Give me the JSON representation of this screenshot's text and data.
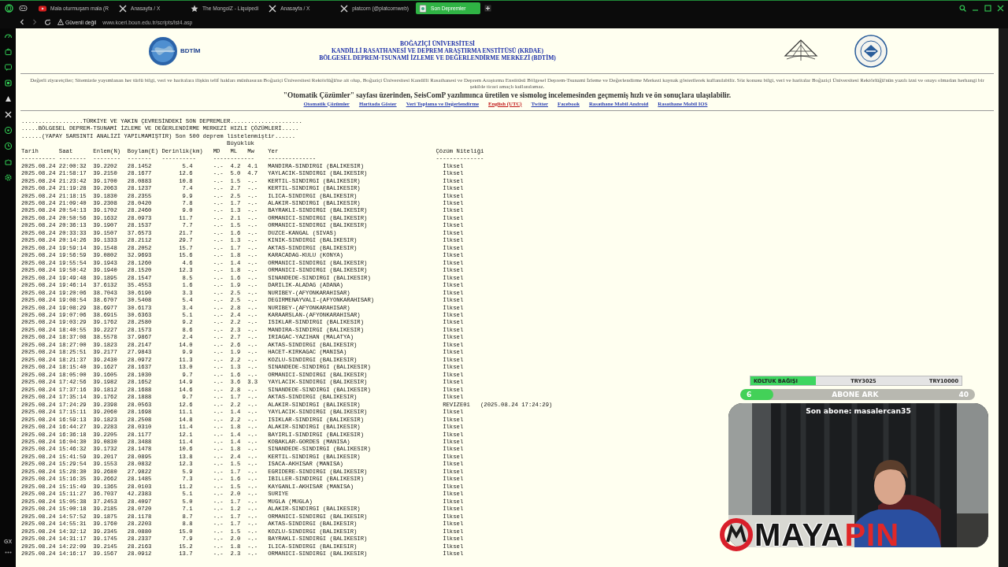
{
  "browser": {
    "tabs": [
      {
        "kind": "video",
        "label": "Mala oturmuşam mala (R",
        "selected": false
      },
      {
        "kind": "x",
        "label": "Anasayfa / X",
        "selected": false
      },
      {
        "kind": "wiki",
        "label": "The MongolZ - Liquipedi",
        "selected": false
      },
      {
        "kind": "x",
        "label": "Anasayfa / X",
        "selected": false
      },
      {
        "kind": "x",
        "label": "platcorn (@platcornweb)",
        "selected": false
      },
      {
        "kind": "page",
        "label": "Son Depremler",
        "selected": true
      }
    ],
    "security": "Güvenli değil",
    "url": "www.koeri.boun.edu.tr/scripts/lst4.asp",
    "sidebar_label": "GX"
  },
  "header": {
    "logo_text": "BDTİM",
    "title_lines": [
      "BOĞAZİÇİ ÜNİVERSİTESİ",
      "KANDİLLİ RASATHANESİ VE DEPREM ARAŞTIRMA ENSTİTÜSÜ (KRDAE)",
      "BÖLGESEL DEPREM-TSUNAMİ İZLEME VE DEĞERLENDİRME MERKEZİ (BDTİM)"
    ],
    "notice": "Değerli ziyaretçiler; Sitemizde yayımlanan her türlü bilgi, veri ve haritalara ilişkin telif hakları münhasıran Boğaziçi Üniversitesi Rektörlüğü'ne ait olup, Boğaziçi Üniversitesi Kandilli Rasathanesi ve Deprem Araştırma Enstitüsü Bölgesel Deprem-Tsunami İzleme ve Değerlendirme Merkezi kaynak gösterilerek kullanılabilir. Söz konusu bilgi, veri ve haritalar Boğaziçi Üniversitesi Rektörlüğü'nün yazılı izni ve onayı olmadan herhangi bir şekilde ticari amaçlı kullanılamaz.",
    "announcement": "\"Otomatik Çözümler\" sayfası üzerinden, SeisComP yazılımınca üretilen ve sismolog incelemesinden geçmemiş hızlı ve ön sonuçlara ulaşılabilir.",
    "links": [
      {
        "kind": "page",
        "label": "Otomatik Çözümler"
      },
      {
        "kind": "page",
        "label": "Haritada Göster"
      },
      {
        "kind": "page",
        "label": "Veri Toplama ve Değerlendirme"
      },
      {
        "kind": "language",
        "label": "English (UTC)"
      },
      {
        "kind": "page",
        "label": "Twitter"
      },
      {
        "kind": "page",
        "label": "Facebook"
      },
      {
        "kind": "page",
        "label": "Rasathane Mobil Android"
      },
      {
        "kind": "page",
        "label": "Rasathane Mobil IOS"
      }
    ]
  },
  "quake_list": {
    "title_lines": [
      "..................TÜRKİYE VE YAKIN ÇEVRESİNDEKİ SON DEPREMLER.....................",
      ".....BÖLGESEL DEPREM-TSUNAMİ İZLEME VE DEĞERLENDİRME MERKEZİ HIZLI ÇÖZÜMLERİ.....",
      "......(YAPAY SARSINTI ANALİZİ YAPILMAMIŞTIR) Son 500 deprem listelenmiştir......"
    ],
    "magnitude_heading": "Büyüklük",
    "columns": [
      {
        "label": "Tarih"
      },
      {
        "label": "Saat"
      },
      {
        "label": "Enlem(N)"
      },
      {
        "label": "Boylam(E)"
      },
      {
        "label": "Derinlik(km)"
      },
      {
        "label": "MD"
      },
      {
        "label": "ML"
      },
      {
        "label": "Mw"
      },
      {
        "label": "Yer"
      },
      {
        "label": "Çözüm Niteliği"
      }
    ],
    "header_rule": "---------- --------  --------  -------   ----------     ------------    --------------                                   --------------",
    "rows": [
      {
        "date": "2025.08.24",
        "time": "22:00:32",
        "lat": "39.2202",
        "lon": "28.1452",
        "depth": "5.4",
        "md": "-.-",
        "ml": "4.2",
        "mw": "4.1",
        "place": "MANDIRA-SINDIRGI (BALIKESIR)",
        "quality": "İlksel"
      },
      {
        "date": "2025.08.24",
        "time": "21:58:17",
        "lat": "39.2150",
        "lon": "28.1677",
        "depth": "12.6",
        "md": "-.-",
        "ml": "5.0",
        "mw": "4.7",
        "place": "YAYLACIK-SINDIRGI (BALIKESIR)",
        "quality": "İlksel"
      },
      {
        "date": "2025.08.24",
        "time": "21:23:42",
        "lat": "39.1700",
        "lon": "28.0883",
        "depth": "10.8",
        "md": "-.-",
        "ml": "1.5",
        "mw": "-.-",
        "place": "KERTIL-SINDIRGI (BALIKESIR)",
        "quality": "İlksel"
      },
      {
        "date": "2025.08.24",
        "time": "21:19:28",
        "lat": "39.2063",
        "lon": "28.1237",
        "depth": "7.4",
        "md": "-.-",
        "ml": "2.7",
        "mw": "-.-",
        "place": "KERTIL-SINDIRGI (BALIKESIR)",
        "quality": "İlksel"
      },
      {
        "date": "2025.08.24",
        "time": "21:18:15",
        "lat": "39.1830",
        "lon": "28.2355",
        "depth": "9.9",
        "md": "-.-",
        "ml": "2.5",
        "mw": "-.-",
        "place": "ILICA-SINDIRGI (BALIKESIR)",
        "quality": "İlksel"
      },
      {
        "date": "2025.08.24",
        "time": "21:09:40",
        "lat": "39.2308",
        "lon": "28.0420",
        "depth": "7.8",
        "md": "-.-",
        "ml": "1.7",
        "mw": "-.-",
        "place": "ALAKIR-SINDIRGI (BALIKESIR)",
        "quality": "İlksel"
      },
      {
        "date": "2025.08.24",
        "time": "20:54:13",
        "lat": "39.1702",
        "lon": "28.2460",
        "depth": "9.0",
        "md": "-.-",
        "ml": "1.3",
        "mw": "-.-",
        "place": "BAYRAKLI-SINDIRGI (BALIKESIR)",
        "quality": "İlksel"
      },
      {
        "date": "2025.08.24",
        "time": "20:50:56",
        "lat": "39.1632",
        "lon": "28.0973",
        "depth": "11.7",
        "md": "-.-",
        "ml": "2.1",
        "mw": "-.-",
        "place": "ORMANICI-SINDIRGI (BALIKESIR)",
        "quality": "İlksel"
      },
      {
        "date": "2025.08.24",
        "time": "20:36:13",
        "lat": "39.1907",
        "lon": "28.1537",
        "depth": "7.7",
        "md": "-.-",
        "ml": "1.5",
        "mw": "-.-",
        "place": "ORMANICI-SINDIRGI (BALIKESIR)",
        "quality": "İlksel"
      },
      {
        "date": "2025.08.24",
        "time": "20:33:33",
        "lat": "39.1507",
        "lon": "37.6573",
        "depth": "21.7",
        "md": "-.-",
        "ml": "1.6",
        "mw": "-.-",
        "place": "DUZCE-KANGAL (SIVAS)",
        "quality": "İlksel"
      },
      {
        "date": "2025.08.24",
        "time": "20:14:26",
        "lat": "39.1333",
        "lon": "28.2112",
        "depth": "29.7",
        "md": "-.-",
        "ml": "1.3",
        "mw": "-.-",
        "place": "KINIK-SINDIRGI (BALIKESIR)",
        "quality": "İlksel"
      },
      {
        "date": "2025.08.24",
        "time": "19:59:14",
        "lat": "39.1548",
        "lon": "28.2052",
        "depth": "15.7",
        "md": "-.-",
        "ml": "1.7",
        "mw": "-.-",
        "place": "AKTAS-SINDIRGI (BALIKESIR)",
        "quality": "İlksel"
      },
      {
        "date": "2025.08.24",
        "time": "19:56:59",
        "lat": "39.0802",
        "lon": "32.9693",
        "depth": "15.6",
        "md": "-.-",
        "ml": "1.8",
        "mw": "-.-",
        "place": "KARACADAG-KULU (KONYA)",
        "quality": "İlksel"
      },
      {
        "date": "2025.08.24",
        "time": "19:55:54",
        "lat": "39.1943",
        "lon": "28.1260",
        "depth": "4.6",
        "md": "-.-",
        "ml": "1.4",
        "mw": "-.-",
        "place": "ORMANICI-SINDIRGI (BALIKESIR)",
        "quality": "İlksel"
      },
      {
        "date": "2025.08.24",
        "time": "19:50:42",
        "lat": "39.1940",
        "lon": "28.1520",
        "depth": "12.3",
        "md": "-.-",
        "ml": "1.8",
        "mw": "-.-",
        "place": "ORMANICI-SINDIRGI (BALIKESIR)",
        "quality": "İlksel"
      },
      {
        "date": "2025.08.24",
        "time": "19:49:48",
        "lat": "39.1895",
        "lon": "28.1547",
        "depth": "8.5",
        "md": "-.-",
        "ml": "1.6",
        "mw": "-.-",
        "place": "SINANDEDE-SINDIRGI (BALIKESIR)",
        "quality": "İlksel"
      },
      {
        "date": "2025.08.24",
        "time": "19:46:14",
        "lat": "37.6132",
        "lon": "35.4553",
        "depth": "1.6",
        "md": "-.-",
        "ml": "1.9",
        "mw": "-.-",
        "place": "DARILIK-ALADAG (ADANA)",
        "quality": "İlksel"
      },
      {
        "date": "2025.08.24",
        "time": "19:20:06",
        "lat": "38.7043",
        "lon": "30.6190",
        "depth": "3.3",
        "md": "-.-",
        "ml": "2.5",
        "mw": "-.-",
        "place": "NURIBEY-(AFYONKARAHISAR)",
        "quality": "İlksel"
      },
      {
        "date": "2025.08.24",
        "time": "19:08:54",
        "lat": "38.6707",
        "lon": "30.5408",
        "depth": "5.4",
        "md": "-.-",
        "ml": "2.5",
        "mw": "-.-",
        "place": "DEGIRMENAYVALI-(AFYONKARAHISAR)",
        "quality": "İlksel"
      },
      {
        "date": "2025.08.24",
        "time": "19:08:29",
        "lat": "38.6977",
        "lon": "30.6173",
        "depth": "3.4",
        "md": "-.-",
        "ml": "2.8",
        "mw": "-.-",
        "place": "NURIBEY-(AFYONKARAHISAR)",
        "quality": "İlksel"
      },
      {
        "date": "2025.08.24",
        "time": "19:07:06",
        "lat": "38.6915",
        "lon": "30.6363",
        "depth": "5.1",
        "md": "-.-",
        "ml": "2.4",
        "mw": "-.-",
        "place": "KARAARSLAN-(AFYONKARAHISAR)",
        "quality": "İlksel"
      },
      {
        "date": "2025.08.24",
        "time": "19:03:29",
        "lat": "39.1762",
        "lon": "28.2580",
        "depth": "9.2",
        "md": "-.-",
        "ml": "2.2",
        "mw": "-.-",
        "place": "ISIKLAR-SINDIRGI (BALIKESIR)",
        "quality": "İlksel"
      },
      {
        "date": "2025.08.24",
        "time": "18:40:55",
        "lat": "39.2227",
        "lon": "28.1573",
        "depth": "8.6",
        "md": "-.-",
        "ml": "2.3",
        "mw": "-.-",
        "place": "MANDIRA-SINDIRGI (BALIKESIR)",
        "quality": "İlksel"
      },
      {
        "date": "2025.08.24",
        "time": "18:37:08",
        "lat": "38.5578",
        "lon": "37.9867",
        "depth": "2.4",
        "md": "-.-",
        "ml": "2.7",
        "mw": "-.-",
        "place": "IRIAGAC-YAZIHAN (MALATYA)",
        "quality": "İlksel"
      },
      {
        "date": "2025.08.24",
        "time": "18:27:00",
        "lat": "39.1823",
        "lon": "28.2147",
        "depth": "14.0",
        "md": "-.-",
        "ml": "2.6",
        "mw": "-.-",
        "place": "AKTAS-SINDIRGI (BALIKESIR)",
        "quality": "İlksel"
      },
      {
        "date": "2025.08.24",
        "time": "18:25:51",
        "lat": "39.2177",
        "lon": "27.9843",
        "depth": "9.9",
        "md": "-.-",
        "ml": "1.9",
        "mw": "-.-",
        "place": "HACET-KIRKAGAC (MANISA)",
        "quality": "İlksel"
      },
      {
        "date": "2025.08.24",
        "time": "18:21:37",
        "lat": "39.2430",
        "lon": "28.0972",
        "depth": "11.3",
        "md": "-.-",
        "ml": "2.2",
        "mw": "-.-",
        "place": "KOZLU-SINDIRGI (BALIKESIR)",
        "quality": "İlksel"
      },
      {
        "date": "2025.08.24",
        "time": "18:15:40",
        "lat": "39.1627",
        "lon": "28.1637",
        "depth": "13.0",
        "md": "-.-",
        "ml": "1.3",
        "mw": "-.-",
        "place": "SINANDEDE-SINDIRGI (BALIKESIR)",
        "quality": "İlksel"
      },
      {
        "date": "2025.08.24",
        "time": "18:05:00",
        "lat": "39.1605",
        "lon": "28.1030",
        "depth": "9.7",
        "md": "-.-",
        "ml": "1.6",
        "mw": "-.-",
        "place": "ORMANICI-SINDIRGI (BALIKESIR)",
        "quality": "İlksel"
      },
      {
        "date": "2025.08.24",
        "time": "17:42:56",
        "lat": "39.1982",
        "lon": "28.1652",
        "depth": "14.9",
        "md": "-.-",
        "ml": "3.6",
        "mw": "3.3",
        "place": "YAYLACIK-SINDIRGI (BALIKESIR)",
        "quality": "İlksel"
      },
      {
        "date": "2025.08.24",
        "time": "17:37:16",
        "lat": "39.1812",
        "lon": "28.1688",
        "depth": "14.6",
        "md": "-.-",
        "ml": "2.8",
        "mw": "-.-",
        "place": "SINANDEDE-SINDIRGI (BALIKESIR)",
        "quality": "İlksel"
      },
      {
        "date": "2025.08.24",
        "time": "17:35:14",
        "lat": "39.1762",
        "lon": "28.1888",
        "depth": "9.7",
        "md": "-.-",
        "ml": "1.7",
        "mw": "-.-",
        "place": "AKTAS-SINDIRGI (BALIKESIR)",
        "quality": "İlksel"
      },
      {
        "date": "2025.08.24",
        "time": "17:24:29",
        "lat": "39.2398",
        "lon": "28.0563",
        "depth": "12.6",
        "md": "-.-",
        "ml": "2.2",
        "mw": "-.-",
        "place": "ALAKIR-SINDIRGI (BALIKESIR)",
        "quality": "REVIZE01",
        "revised_at": "(2025.08.24 17:24:29)"
      },
      {
        "date": "2025.08.24",
        "time": "17:15:11",
        "lat": "39.2060",
        "lon": "28.1698",
        "depth": "11.1",
        "md": "-.-",
        "ml": "1.4",
        "mw": "-.-",
        "place": "YAYLACIK-SINDIRGI (BALIKESIR)",
        "quality": "İlksel"
      },
      {
        "date": "2025.08.24",
        "time": "16:59:13",
        "lat": "39.1823",
        "lon": "28.2508",
        "depth": "14.8",
        "md": "-.-",
        "ml": "2.2",
        "mw": "-.-",
        "place": "ISIKLAR-SINDIRGI (BALIKESIR)",
        "quality": "İlksel"
      },
      {
        "date": "2025.08.24",
        "time": "16:44:27",
        "lat": "39.2283",
        "lon": "28.0310",
        "depth": "11.4",
        "md": "-.-",
        "ml": "1.8",
        "mw": "-.-",
        "place": "ALAKIR-SINDIRGI (BALIKESIR)",
        "quality": "İlksel"
      },
      {
        "date": "2025.08.24",
        "time": "16:36:18",
        "lat": "39.2205",
        "lon": "28.1177",
        "depth": "12.1",
        "md": "-.-",
        "ml": "1.4",
        "mw": "-.-",
        "place": "BAYIRLI-SINDIRGI (BALIKESIR)",
        "quality": "İlksel"
      },
      {
        "date": "2025.08.24",
        "time": "16:04:30",
        "lat": "39.0830",
        "lon": "28.3488",
        "depth": "11.4",
        "md": "-.-",
        "ml": "1.4",
        "mw": "-.-",
        "place": "KOBAKLAR-GORDES (MANISA)",
        "quality": "İlksel"
      },
      {
        "date": "2025.08.24",
        "time": "15:46:32",
        "lat": "39.1732",
        "lon": "28.1478",
        "depth": "10.6",
        "md": "-.-",
        "ml": "1.8",
        "mw": "-.-",
        "place": "SINANDEDE-SINDIRGI (BALIKESIR)",
        "quality": "İlksel"
      },
      {
        "date": "2025.08.24",
        "time": "15:41:59",
        "lat": "39.2017",
        "lon": "28.0895",
        "depth": "13.8",
        "md": "-.-",
        "ml": "2.4",
        "mw": "-.-",
        "place": "KERTIL-SINDIRGI (BALIKESIR)",
        "quality": "İlksel"
      },
      {
        "date": "2025.08.24",
        "time": "15:29:54",
        "lat": "39.1553",
        "lon": "28.0832",
        "depth": "12.3",
        "md": "-.-",
        "ml": "1.5",
        "mw": "-.-",
        "place": "ISACA-AKHISAR (MANISA)",
        "quality": "İlksel"
      },
      {
        "date": "2025.08.24",
        "time": "15:28:30",
        "lat": "39.2680",
        "lon": "27.9822",
        "depth": "5.9",
        "md": "-.-",
        "ml": "1.7",
        "mw": "-.-",
        "place": "EGRIDERE-SINDIRGI (BALIKESIR)",
        "quality": "İlksel"
      },
      {
        "date": "2025.08.24",
        "time": "15:16:35",
        "lat": "39.2662",
        "lon": "28.1485",
        "depth": "7.3",
        "md": "-.-",
        "ml": "1.6",
        "mw": "-.-",
        "place": "IBILLER-SINDIRGI (BALIKESIR)",
        "quality": "İlksel"
      },
      {
        "date": "2025.08.24",
        "time": "15:15:49",
        "lat": "39.1365",
        "lon": "28.0103",
        "depth": "11.2",
        "md": "-.-",
        "ml": "1.5",
        "mw": "-.-",
        "place": "KAYGANLI-AKHISAR (MANISA)",
        "quality": "İlksel"
      },
      {
        "date": "2025.08.24",
        "time": "15:11:27",
        "lat": "36.7037",
        "lon": "42.2383",
        "depth": "5.1",
        "md": "-.-",
        "ml": "2.0",
        "mw": "-.-",
        "place": "SURIYE",
        "quality": "İlksel"
      },
      {
        "date": "2025.08.24",
        "time": "15:05:38",
        "lat": "37.2453",
        "lon": "28.4097",
        "depth": "5.0",
        "md": "-.-",
        "ml": "1.7",
        "mw": "-.-",
        "place": "MUGLA (MUGLA)",
        "quality": "İlksel"
      },
      {
        "date": "2025.08.24",
        "time": "15:00:18",
        "lat": "39.2185",
        "lon": "28.0720",
        "depth": "7.1",
        "md": "-.-",
        "ml": "1.2",
        "mw": "-.-",
        "place": "ALAKIR-SINDIRGI (BALIKESIR)",
        "quality": "İlksel"
      },
      {
        "date": "2025.08.24",
        "time": "14:57:52",
        "lat": "39.1875",
        "lon": "28.1178",
        "depth": "8.7",
        "md": "-.-",
        "ml": "1.7",
        "mw": "-.-",
        "place": "ORMANICI-SINDIRGI (BALIKESIR)",
        "quality": "İlksel"
      },
      {
        "date": "2025.08.24",
        "time": "14:55:31",
        "lat": "39.1760",
        "lon": "28.2203",
        "depth": "8.8",
        "md": "-.-",
        "ml": "1.7",
        "mw": "-.-",
        "place": "AKTAS-SINDIRGI (BALIKESIR)",
        "quality": "İlksel"
      },
      {
        "date": "2025.08.24",
        "time": "14:32:12",
        "lat": "39.2345",
        "lon": "28.0880",
        "depth": "15.0",
        "md": "-.-",
        "ml": "1.5",
        "mw": "-.-",
        "place": "KOZLU-SINDIRGI (BALIKESIR)",
        "quality": "İlksel"
      },
      {
        "date": "2025.08.24",
        "time": "14:31:17",
        "lat": "39.1745",
        "lon": "28.2337",
        "depth": "7.9",
        "md": "-.-",
        "ml": "2.0",
        "mw": "-.-",
        "place": "BAYRAKLI-SINDIRGI (BALIKESIR)",
        "quality": "İlksel"
      },
      {
        "date": "2025.08.24",
        "time": "14:22:09",
        "lat": "39.2145",
        "lon": "28.2163",
        "depth": "15.2",
        "md": "-.-",
        "ml": "1.8",
        "mw": "-.-",
        "place": "ILICA-SINDIRGI (BALIKESIR)",
        "quality": "İlksel"
      },
      {
        "date": "2025.08.24",
        "time": "14:16:17",
        "lat": "39.1567",
        "lon": "28.0912",
        "depth": "13.7",
        "md": "-.-",
        "ml": "2.3",
        "mw": "-.-",
        "place": "ORMANICI-SINDIRGI (BALIKESIR)",
        "quality": "İlksel"
      }
    ]
  },
  "stream_overlay": {
    "donation_goal": {
      "label": "KOLTUK BAĞIŞI",
      "current": "TRY3025",
      "target": "TRY10000",
      "level": 0.31
    },
    "sub_goal": {
      "current": "6",
      "label": "ABONE ARK",
      "target": "40",
      "level": 0.14
    },
    "camera": {
      "kind": "picture",
      "caption": "Son abone: masalercan35"
    },
    "logo": {
      "parts": [
        "MAYA",
        "PIN"
      ]
    }
  }
}
